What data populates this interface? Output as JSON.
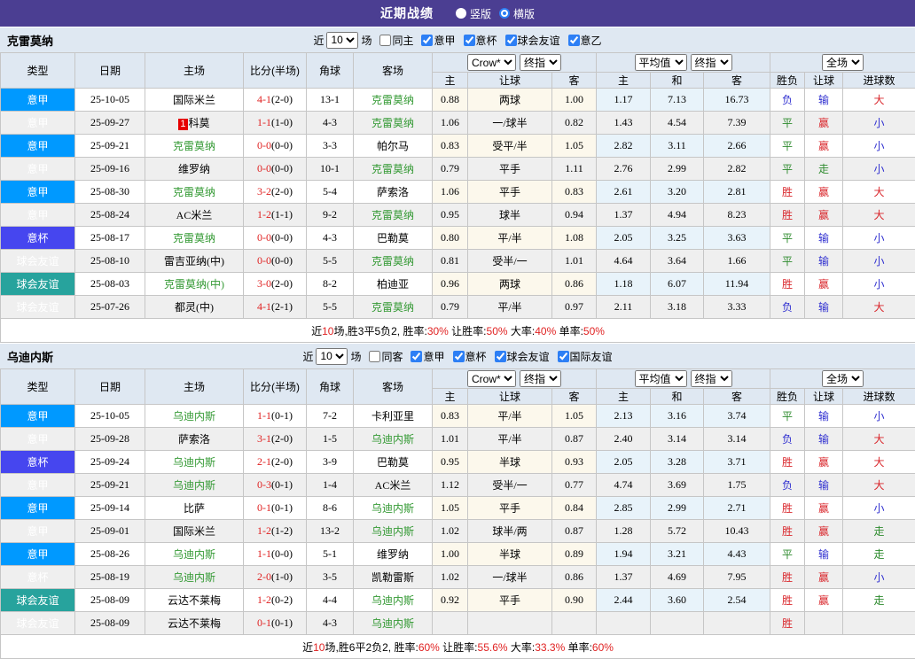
{
  "header": {
    "title": "近期战绩",
    "vertical_label": "竖版",
    "horizontal_label": "横版",
    "selected": "横版"
  },
  "table_columns": {
    "main": [
      "类型",
      "日期",
      "主场",
      "比分(半场)",
      "角球",
      "客场"
    ],
    "sub": [
      "主",
      "让球",
      "客",
      "主",
      "和",
      "客",
      "胜负",
      "让球",
      "进球数"
    ],
    "group_selects": [
      [
        "Crow*",
        "终指"
      ],
      [
        "平均值",
        "终指"
      ],
      [
        "全场"
      ]
    ]
  },
  "league_colors": {
    "意甲": "#0099ff",
    "意杯": "#4646ef",
    "球会友谊": "#27a39d"
  },
  "result_colors": {
    "r": "#d9262b",
    "g": "#2e8b2e",
    "b": "#3030d0"
  },
  "sections": [
    {
      "team": "克雷莫纳",
      "filter": {
        "prefix": "近",
        "games": "10",
        "suffix": "场",
        "same": {
          "label": "同主",
          "checked": false
        },
        "leagues": [
          {
            "label": "意甲",
            "checked": true
          },
          {
            "label": "意杯",
            "checked": true
          },
          {
            "label": "球会友谊",
            "checked": true
          },
          {
            "label": "意乙",
            "checked": true
          }
        ]
      },
      "rows": [
        {
          "type": "意甲",
          "date": "25-10-05",
          "home": "国际米兰",
          "home_green": false,
          "home_badge": "",
          "score": "4-1",
          "half": "(2-0)",
          "corner": "13-1",
          "away": "克雷莫纳",
          "away_green": true,
          "odds": [
            "0.88",
            "两球",
            "1.00"
          ],
          "europe": [
            "1.17",
            "7.13",
            "16.73"
          ],
          "results": [
            [
              "负",
              "b"
            ],
            [
              "输",
              "b"
            ],
            [
              "大",
              "r"
            ]
          ]
        },
        {
          "type": "意甲",
          "date": "25-09-27",
          "home": "科莫",
          "home_green": false,
          "home_badge": "1",
          "score": "1-1",
          "half": "(1-0)",
          "corner": "4-3",
          "away": "克雷莫纳",
          "away_green": true,
          "odds": [
            "1.06",
            "一/球半",
            "0.82"
          ],
          "europe": [
            "1.43",
            "4.54",
            "7.39"
          ],
          "results": [
            [
              "平",
              "g"
            ],
            [
              "赢",
              "r"
            ],
            [
              "小",
              "b"
            ]
          ]
        },
        {
          "type": "意甲",
          "date": "25-09-21",
          "home": "克雷莫纳",
          "home_green": true,
          "home_badge": "",
          "score": "0-0",
          "half": "(0-0)",
          "corner": "3-3",
          "away": "帕尔马",
          "away_green": false,
          "odds": [
            "0.83",
            "受平/半",
            "1.05"
          ],
          "europe": [
            "2.82",
            "3.11",
            "2.66"
          ],
          "results": [
            [
              "平",
              "g"
            ],
            [
              "赢",
              "r"
            ],
            [
              "小",
              "b"
            ]
          ]
        },
        {
          "type": "意甲",
          "date": "25-09-16",
          "home": "维罗纳",
          "home_green": false,
          "home_badge": "",
          "score": "0-0",
          "half": "(0-0)",
          "corner": "10-1",
          "away": "克雷莫纳",
          "away_green": true,
          "odds": [
            "0.79",
            "平手",
            "1.11"
          ],
          "europe": [
            "2.76",
            "2.99",
            "2.82"
          ],
          "results": [
            [
              "平",
              "g"
            ],
            [
              "走",
              "g"
            ],
            [
              "小",
              "b"
            ]
          ]
        },
        {
          "type": "意甲",
          "date": "25-08-30",
          "home": "克雷莫纳",
          "home_green": true,
          "home_badge": "",
          "score": "3-2",
          "half": "(2-0)",
          "corner": "5-4",
          "away": "萨索洛",
          "away_green": false,
          "odds": [
            "1.06",
            "平手",
            "0.83"
          ],
          "europe": [
            "2.61",
            "3.20",
            "2.81"
          ],
          "results": [
            [
              "胜",
              "r"
            ],
            [
              "赢",
              "r"
            ],
            [
              "大",
              "r"
            ]
          ]
        },
        {
          "type": "意甲",
          "date": "25-08-24",
          "home": "AC米兰",
          "home_green": false,
          "home_badge": "",
          "score": "1-2",
          "half": "(1-1)",
          "corner": "9-2",
          "away": "克雷莫纳",
          "away_green": true,
          "odds": [
            "0.95",
            "球半",
            "0.94"
          ],
          "europe": [
            "1.37",
            "4.94",
            "8.23"
          ],
          "results": [
            [
              "胜",
              "r"
            ],
            [
              "赢",
              "r"
            ],
            [
              "大",
              "r"
            ]
          ]
        },
        {
          "type": "意杯",
          "date": "25-08-17",
          "home": "克雷莫纳",
          "home_green": true,
          "home_badge": "",
          "score": "0-0",
          "half": "(0-0)",
          "corner": "4-3",
          "away": "巴勒莫",
          "away_green": false,
          "odds": [
            "0.80",
            "平/半",
            "1.08"
          ],
          "europe": [
            "2.05",
            "3.25",
            "3.63"
          ],
          "results": [
            [
              "平",
              "g"
            ],
            [
              "输",
              "b"
            ],
            [
              "小",
              "b"
            ]
          ]
        },
        {
          "type": "球会友谊",
          "date": "25-08-10",
          "home": "雷吉亚纳(中)",
          "home_green": false,
          "home_badge": "",
          "score": "0-0",
          "half": "(0-0)",
          "corner": "5-5",
          "away": "克雷莫纳",
          "away_green": true,
          "odds": [
            "0.81",
            "受半/一",
            "1.01"
          ],
          "europe": [
            "4.64",
            "3.64",
            "1.66"
          ],
          "results": [
            [
              "平",
              "g"
            ],
            [
              "输",
              "b"
            ],
            [
              "小",
              "b"
            ]
          ]
        },
        {
          "type": "球会友谊",
          "date": "25-08-03",
          "home": "克雷莫纳(中)",
          "home_green": true,
          "home_badge": "",
          "score": "3-0",
          "half": "(2-0)",
          "corner": "8-2",
          "away": "柏迪亚",
          "away_green": false,
          "odds": [
            "0.96",
            "两球",
            "0.86"
          ],
          "europe": [
            "1.18",
            "6.07",
            "11.94"
          ],
          "results": [
            [
              "胜",
              "r"
            ],
            [
              "赢",
              "r"
            ],
            [
              "小",
              "b"
            ]
          ]
        },
        {
          "type": "球会友谊",
          "date": "25-07-26",
          "home": "都灵(中)",
          "home_green": false,
          "home_badge": "",
          "score": "4-1",
          "half": "(2-1)",
          "corner": "5-5",
          "away": "克雷莫纳",
          "away_green": true,
          "odds": [
            "0.79",
            "平/半",
            "0.97"
          ],
          "europe": [
            "2.11",
            "3.18",
            "3.33"
          ],
          "results": [
            [
              "负",
              "b"
            ],
            [
              "输",
              "b"
            ],
            [
              "大",
              "r"
            ]
          ]
        }
      ],
      "summary": [
        [
          "近",
          false
        ],
        [
          "10",
          true
        ],
        [
          "场,胜3平5负2, 胜率:",
          false
        ],
        [
          "30%",
          true
        ],
        [
          " 让胜率:",
          false
        ],
        [
          "50%",
          true
        ],
        [
          " 大率:",
          false
        ],
        [
          "40%",
          true
        ],
        [
          " 单率:",
          false
        ],
        [
          "50%",
          true
        ]
      ]
    },
    {
      "team": "乌迪内斯",
      "filter": {
        "prefix": "近",
        "games": "10",
        "suffix": "场",
        "same": {
          "label": "同客",
          "checked": false
        },
        "leagues": [
          {
            "label": "意甲",
            "checked": true
          },
          {
            "label": "意杯",
            "checked": true
          },
          {
            "label": "球会友谊",
            "checked": true
          },
          {
            "label": "国际友谊",
            "checked": true
          }
        ]
      },
      "rows": [
        {
          "type": "意甲",
          "date": "25-10-05",
          "home": "乌迪内斯",
          "home_green": true,
          "home_badge": "",
          "score": "1-1",
          "half": "(0-1)",
          "corner": "7-2",
          "away": "卡利亚里",
          "away_green": false,
          "odds": [
            "0.83",
            "平/半",
            "1.05"
          ],
          "europe": [
            "2.13",
            "3.16",
            "3.74"
          ],
          "results": [
            [
              "平",
              "g"
            ],
            [
              "输",
              "b"
            ],
            [
              "小",
              "b"
            ]
          ]
        },
        {
          "type": "意甲",
          "date": "25-09-28",
          "home": "萨索洛",
          "home_green": false,
          "home_badge": "",
          "score": "3-1",
          "half": "(2-0)",
          "corner": "1-5",
          "away": "乌迪内斯",
          "away_green": true,
          "odds": [
            "1.01",
            "平/半",
            "0.87"
          ],
          "europe": [
            "2.40",
            "3.14",
            "3.14"
          ],
          "results": [
            [
              "负",
              "b"
            ],
            [
              "输",
              "b"
            ],
            [
              "大",
              "r"
            ]
          ]
        },
        {
          "type": "意杯",
          "date": "25-09-24",
          "home": "乌迪内斯",
          "home_green": true,
          "home_badge": "",
          "score": "2-1",
          "half": "(2-0)",
          "corner": "3-9",
          "away": "巴勒莫",
          "away_green": false,
          "odds": [
            "0.95",
            "半球",
            "0.93"
          ],
          "europe": [
            "2.05",
            "3.28",
            "3.71"
          ],
          "results": [
            [
              "胜",
              "r"
            ],
            [
              "赢",
              "r"
            ],
            [
              "大",
              "r"
            ]
          ]
        },
        {
          "type": "意甲",
          "date": "25-09-21",
          "home": "乌迪内斯",
          "home_green": true,
          "home_badge": "",
          "score": "0-3",
          "half": "(0-1)",
          "corner": "1-4",
          "away": "AC米兰",
          "away_green": false,
          "odds": [
            "1.12",
            "受半/一",
            "0.77"
          ],
          "europe": [
            "4.74",
            "3.69",
            "1.75"
          ],
          "results": [
            [
              "负",
              "b"
            ],
            [
              "输",
              "b"
            ],
            [
              "大",
              "r"
            ]
          ]
        },
        {
          "type": "意甲",
          "date": "25-09-14",
          "home": "比萨",
          "home_green": false,
          "home_badge": "",
          "score": "0-1",
          "half": "(0-1)",
          "corner": "8-6",
          "away": "乌迪内斯",
          "away_green": true,
          "odds": [
            "1.05",
            "平手",
            "0.84"
          ],
          "europe": [
            "2.85",
            "2.99",
            "2.71"
          ],
          "results": [
            [
              "胜",
              "r"
            ],
            [
              "赢",
              "r"
            ],
            [
              "小",
              "b"
            ]
          ]
        },
        {
          "type": "意甲",
          "date": "25-09-01",
          "home": "国际米兰",
          "home_green": false,
          "home_badge": "",
          "score": "1-2",
          "half": "(1-2)",
          "corner": "13-2",
          "away": "乌迪内斯",
          "away_green": true,
          "odds": [
            "1.02",
            "球半/两",
            "0.87"
          ],
          "europe": [
            "1.28",
            "5.72",
            "10.43"
          ],
          "results": [
            [
              "胜",
              "r"
            ],
            [
              "赢",
              "r"
            ],
            [
              "走",
              "g"
            ]
          ]
        },
        {
          "type": "意甲",
          "date": "25-08-26",
          "home": "乌迪内斯",
          "home_green": true,
          "home_badge": "",
          "score": "1-1",
          "half": "(0-0)",
          "corner": "5-1",
          "away": "维罗纳",
          "away_green": false,
          "odds": [
            "1.00",
            "半球",
            "0.89"
          ],
          "europe": [
            "1.94",
            "3.21",
            "4.43"
          ],
          "results": [
            [
              "平",
              "g"
            ],
            [
              "输",
              "b"
            ],
            [
              "走",
              "g"
            ]
          ]
        },
        {
          "type": "意杯",
          "date": "25-08-19",
          "home": "乌迪内斯",
          "home_green": true,
          "home_badge": "",
          "score": "2-0",
          "half": "(1-0)",
          "corner": "3-5",
          "away": "凯勒雷斯",
          "away_green": false,
          "odds": [
            "1.02",
            "一/球半",
            "0.86"
          ],
          "europe": [
            "1.37",
            "4.69",
            "7.95"
          ],
          "results": [
            [
              "胜",
              "r"
            ],
            [
              "赢",
              "r"
            ],
            [
              "小",
              "b"
            ]
          ]
        },
        {
          "type": "球会友谊",
          "date": "25-08-09",
          "home": "云达不莱梅",
          "home_green": false,
          "home_badge": "",
          "score": "1-2",
          "half": "(0-2)",
          "corner": "4-4",
          "away": "乌迪内斯",
          "away_green": true,
          "odds": [
            "0.92",
            "平手",
            "0.90"
          ],
          "europe": [
            "2.44",
            "3.60",
            "2.54"
          ],
          "results": [
            [
              "胜",
              "r"
            ],
            [
              "赢",
              "r"
            ],
            [
              "走",
              "g"
            ]
          ]
        },
        {
          "type": "球会友谊",
          "date": "25-08-09",
          "home": "云达不莱梅",
          "home_green": false,
          "home_badge": "",
          "score": "0-1",
          "half": "(0-1)",
          "corner": "4-3",
          "away": "乌迪内斯",
          "away_green": true,
          "odds": [
            "",
            "",
            ""
          ],
          "europe": [
            "",
            "",
            ""
          ],
          "results": [
            [
              "胜",
              "r"
            ],
            [
              "",
              ""
            ],
            [
              "",
              ""
            ]
          ]
        }
      ],
      "summary": [
        [
          "近",
          false
        ],
        [
          "10",
          true
        ],
        [
          "场,胜6平2负2, 胜率:",
          false
        ],
        [
          "60%",
          true
        ],
        [
          " 让胜率:",
          false
        ],
        [
          "55.6%",
          true
        ],
        [
          " 大率:",
          false
        ],
        [
          "33.3%",
          true
        ],
        [
          " 单率:",
          false
        ],
        [
          "60%",
          true
        ]
      ]
    }
  ]
}
